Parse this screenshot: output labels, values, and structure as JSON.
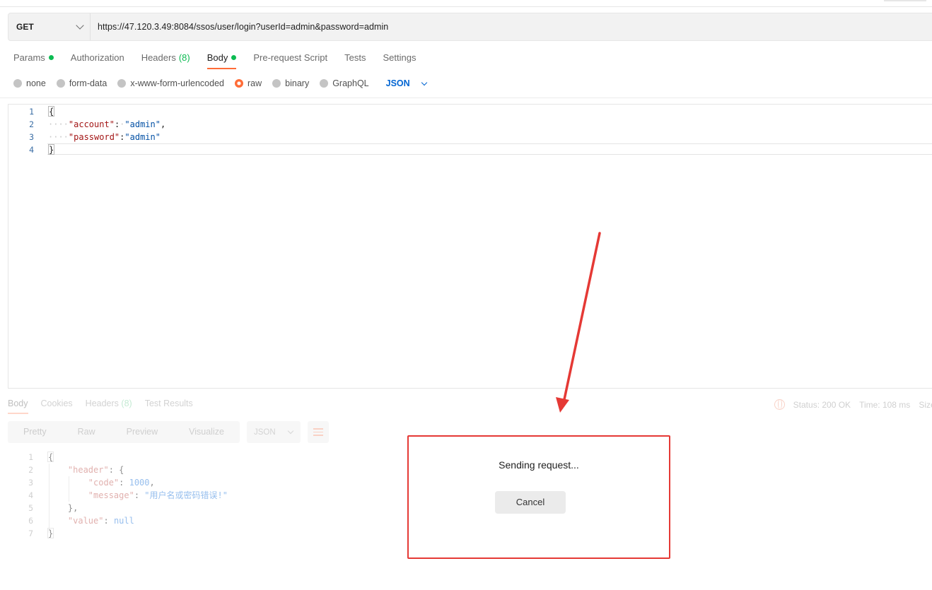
{
  "request": {
    "method": "GET",
    "url": "https://47.120.3.49:8084/ssos/user/login?userId=admin&password=admin"
  },
  "request_tabs": [
    {
      "label": "Params",
      "indicator": "dot"
    },
    {
      "label": "Authorization"
    },
    {
      "label": "Headers",
      "count": "(8)"
    },
    {
      "label": "Body",
      "indicator": "dot",
      "active": true
    },
    {
      "label": "Pre-request Script"
    },
    {
      "label": "Tests"
    },
    {
      "label": "Settings"
    }
  ],
  "body_types": {
    "none": "none",
    "form_data": "form-data",
    "urlencoded": "x-www-form-urlencoded",
    "raw": "raw",
    "binary": "binary",
    "graphql": "GraphQL",
    "format": "JSON",
    "selected": "raw"
  },
  "editor": {
    "lines": [
      {
        "n": "1",
        "open": "{"
      },
      {
        "n": "2",
        "indent": "····",
        "key": "\"account\"",
        "sep": ":",
        "dotsep": "·",
        "value": "\"admin\"",
        "tail": ","
      },
      {
        "n": "3",
        "indent": "····",
        "key": "\"password\"",
        "sep": ":",
        "value": "\"admin\""
      },
      {
        "n": "4",
        "close": "}"
      }
    ]
  },
  "response": {
    "tabs": {
      "body": "Body",
      "cookies": "Cookies",
      "headers": "Headers",
      "headers_count": "(8)",
      "test_results": "Test Results"
    },
    "status": "Status: 200 OK",
    "time": "Time: 108 ms",
    "size": "Size:",
    "views": {
      "pretty": "Pretty",
      "raw": "Raw",
      "preview": "Preview",
      "visualize": "Visualize",
      "format": "JSON"
    },
    "lines": [
      {
        "n": "1",
        "text": "{"
      },
      {
        "n": "2",
        "key": "\"header\"",
        "rest": ": {"
      },
      {
        "n": "3",
        "key": "\"code\"",
        "rest": ": ",
        "num": "1000",
        "tail": ","
      },
      {
        "n": "4",
        "key": "\"message\"",
        "rest": ": ",
        "str": "\"用户名或密码错误!\""
      },
      {
        "n": "5",
        "text": "},"
      },
      {
        "n": "6",
        "key": "\"value\"",
        "rest": ": ",
        "num": "null"
      },
      {
        "n": "7",
        "text": "}"
      }
    ]
  },
  "modal": {
    "title": "Sending request...",
    "cancel": "Cancel"
  },
  "colors": {
    "accent": "#ff6c37",
    "success": "#0cbb52",
    "link": "#0265d2",
    "annotation": "#e53935"
  }
}
